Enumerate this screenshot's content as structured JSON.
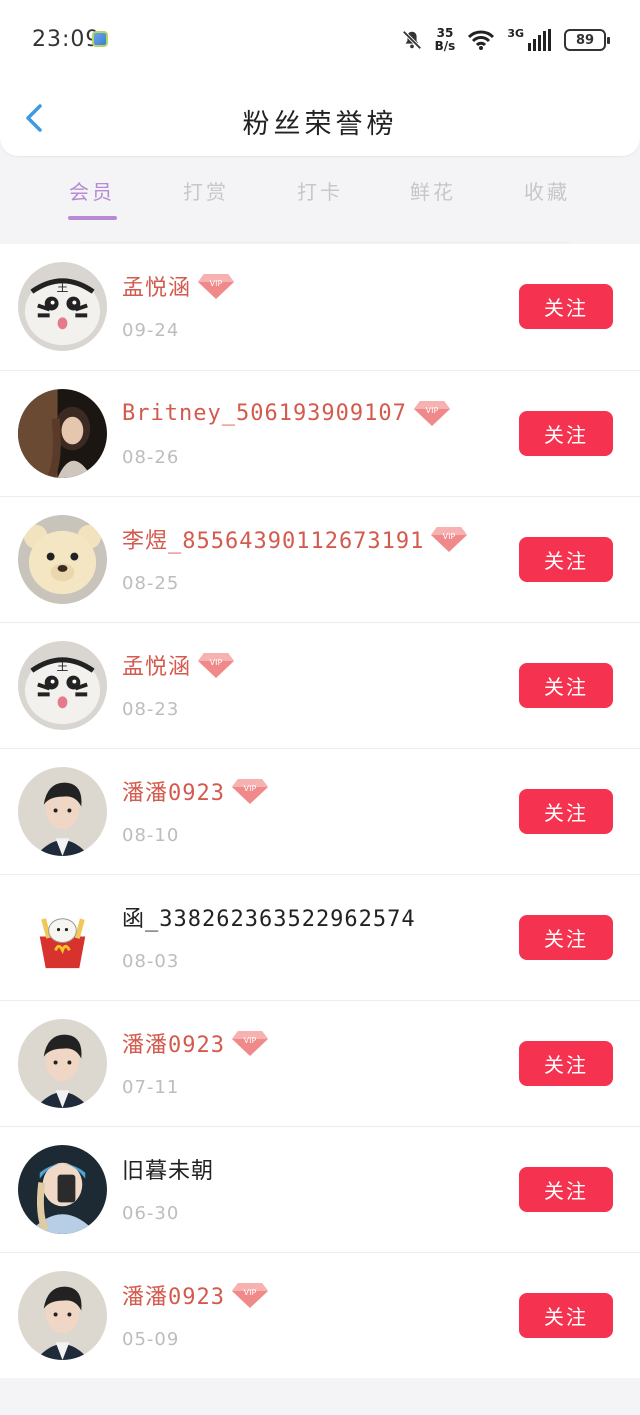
{
  "status_bar": {
    "time": "23:09",
    "net_speed_value": "35",
    "net_speed_unit": "B/s",
    "network_type": "3G",
    "battery": "89"
  },
  "header": {
    "title": "粉丝荣誉榜"
  },
  "tabs": [
    {
      "label": "会员",
      "active": true
    },
    {
      "label": "打赏",
      "active": false
    },
    {
      "label": "打卡",
      "active": false
    },
    {
      "label": "鲜花",
      "active": false
    },
    {
      "label": "收藏",
      "active": false
    }
  ],
  "colors": {
    "accent_purple": "#b78ad6",
    "follow_button": "#f5324f",
    "vip_name": "#d45a4e"
  },
  "icons": {
    "back": "chevron-left-icon",
    "vip": "diamond-vip-icon",
    "mute": "bell-off-icon",
    "wifi": "wifi-icon",
    "signal": "signal-icon"
  },
  "follow_label": "关注",
  "vip_badge_text": "VIP",
  "fans": [
    {
      "name": "孟悦涵",
      "date": "09-24",
      "vip": true,
      "avatar": "tiger"
    },
    {
      "name": "Britney_506193909107",
      "date": "08-26",
      "vip": true,
      "avatar": "girl"
    },
    {
      "name": "李煜_85564390112673191",
      "date": "08-25",
      "vip": true,
      "avatar": "bear"
    },
    {
      "name": "孟悦涵",
      "date": "08-23",
      "vip": true,
      "avatar": "tiger"
    },
    {
      "name": "潘潘0923",
      "date": "08-10",
      "vip": true,
      "avatar": "boy"
    },
    {
      "name": "函_338262363522962574",
      "date": "08-03",
      "vip": false,
      "avatar": "fries"
    },
    {
      "name": "潘潘0923",
      "date": "07-11",
      "vip": true,
      "avatar": "boy"
    },
    {
      "name": "旧暮未朝",
      "date": "06-30",
      "vip": false,
      "avatar": "selfie"
    },
    {
      "name": "潘潘0923",
      "date": "05-09",
      "vip": true,
      "avatar": "boy"
    }
  ]
}
